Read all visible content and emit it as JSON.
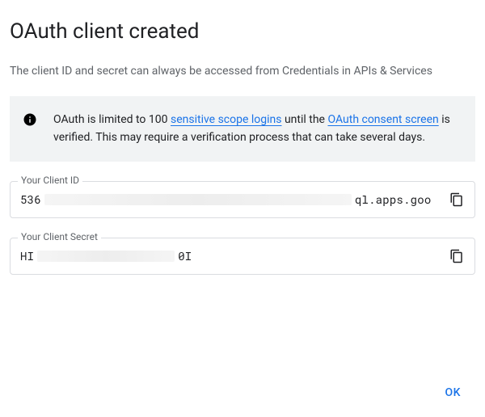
{
  "dialog": {
    "title": "OAuth client created",
    "subtitle": "The client ID and secret can always be accessed from Credentials in APIs & Services",
    "info": {
      "pre": "OAuth is limited to 100 ",
      "link1": "sensitive scope logins",
      "mid1": " until the ",
      "link2": "OAuth consent screen",
      "post": " is verified. This may require a verification process that can take several days."
    },
    "client_id": {
      "label": "Your Client ID",
      "prefix": "536",
      "suffix": "ql.apps.goo"
    },
    "client_secret": {
      "label": "Your Client Secret",
      "prefix": "HI",
      "suffix": "0I"
    },
    "ok": "OK"
  }
}
